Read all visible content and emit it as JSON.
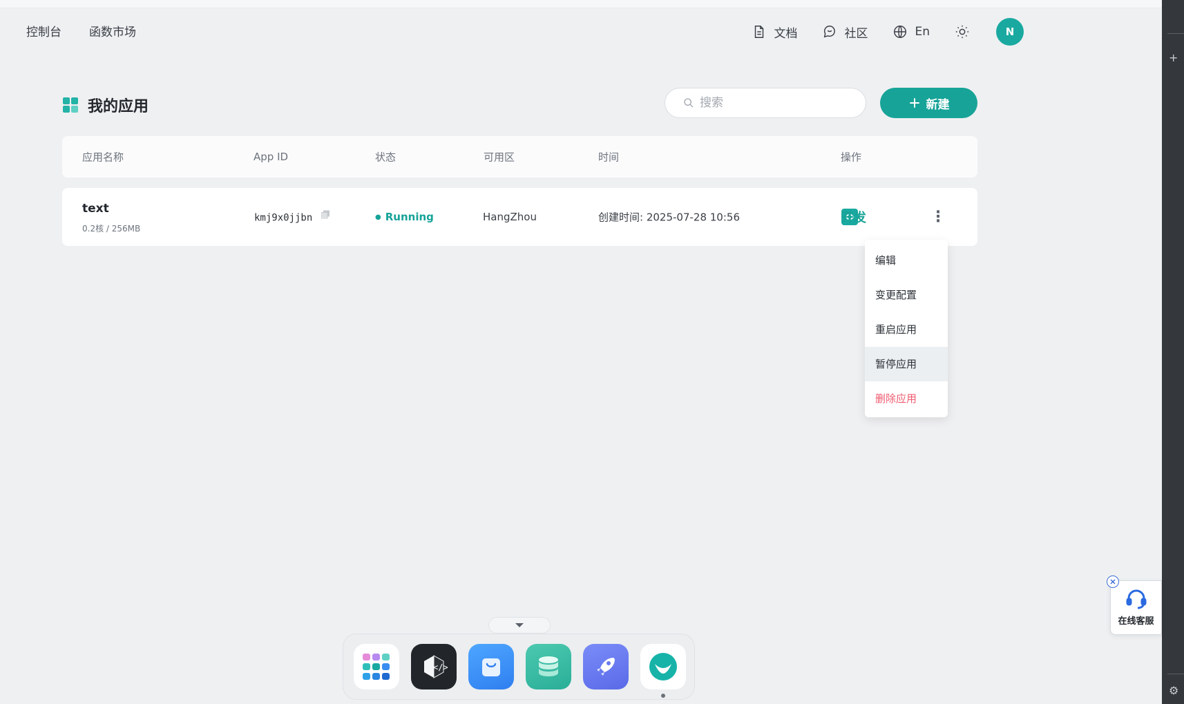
{
  "topnav": {
    "console": "控制台",
    "function_market": "函数市场",
    "docs": "文档",
    "community": "社区",
    "language": "En",
    "theme_icon": "sun-icon",
    "avatar_initial": "N"
  },
  "page": {
    "title": "我的应用"
  },
  "search": {
    "placeholder": "搜索",
    "value": ""
  },
  "new_button": {
    "label": "新建"
  },
  "table": {
    "headers": [
      "应用名称",
      "App ID",
      "状态",
      "可用区",
      "时间",
      "操作"
    ],
    "rows": [
      {
        "name": "text",
        "spec": "0.2核 / 256MB",
        "app_id": "kmj9x0jjbn",
        "status": "Running",
        "region": "HangZhou",
        "time": "创建时间: 2025-07-28 10:56",
        "action": "开发"
      }
    ]
  },
  "menu": {
    "items": [
      "编辑",
      "变更配置",
      "重启应用",
      "暂停应用",
      "删除应用"
    ],
    "hovered": "暂停应用",
    "danger": "删除应用"
  },
  "dock": {
    "apps": [
      "app-launcher-icon",
      "code-editor-icon",
      "market-bag-icon",
      "database-icon",
      "rocket-icon",
      "brand-logo-icon"
    ],
    "active": "brand-logo-icon"
  },
  "support": {
    "label": "在线客服"
  },
  "colors": {
    "accent": "#17a398",
    "danger": "#ef5a6f",
    "background": "#eff0f2"
  }
}
